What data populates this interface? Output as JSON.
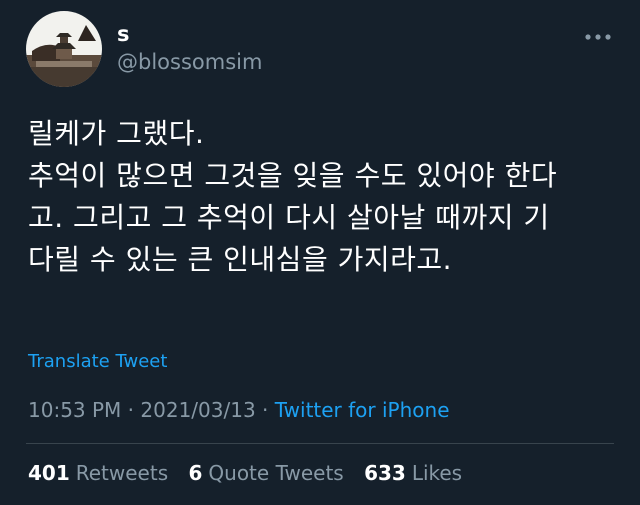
{
  "author": {
    "display_name": "s",
    "handle": "@blossomsim"
  },
  "tweet": {
    "lines": [
      "릴케가 그랬다.",
      "추억이 많으면 그것을 잊을 수도 있어야 한다",
      "고. 그리고 그 추억이 다시 살아날 때까지 기",
      "다릴 수 있는 큰 인내심을 가지라고."
    ],
    "translate_label": "Translate Tweet"
  },
  "meta": {
    "time": "10:53 PM",
    "separator": " · ",
    "date": "2021/03/13",
    "source": "Twitter for iPhone"
  },
  "stats": {
    "retweets_count": "401",
    "retweets_label": "Retweets",
    "quote_count": "6",
    "quote_label": "Quote Tweets",
    "likes_count": "633",
    "likes_label": "Likes"
  },
  "icons": {
    "more": "more-dots-icon"
  },
  "colors": {
    "background": "#15202b",
    "text_primary": "#ffffff",
    "text_secondary": "#8899a6",
    "accent": "#1da1f2",
    "divider": "#38444d"
  }
}
